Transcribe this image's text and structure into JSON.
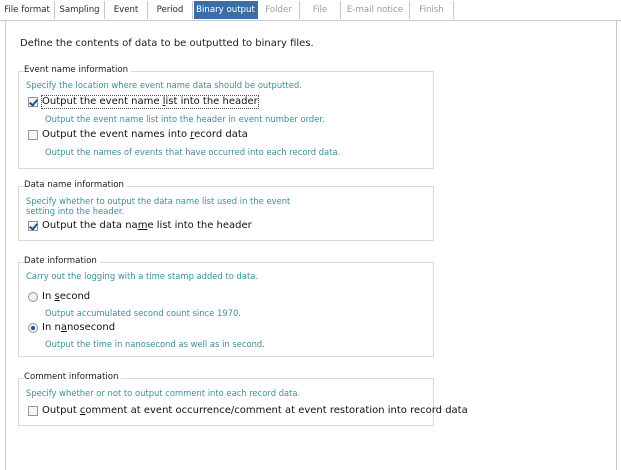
{
  "tabs": [
    {
      "label": "File format",
      "state": "normal"
    },
    {
      "label": "Sampling",
      "state": "normal"
    },
    {
      "label": "Event",
      "state": "normal"
    },
    {
      "label": "Period",
      "state": "normal"
    },
    {
      "label": "Binary output",
      "state": "active"
    },
    {
      "label": "Folder",
      "state": "disabled"
    },
    {
      "label": "File",
      "state": "disabled"
    },
    {
      "label": "E-mail notice",
      "state": "disabled"
    },
    {
      "label": "Finish",
      "state": "disabled"
    }
  ],
  "intro": "Define the contents of data to be outputted to binary files.",
  "event_name": {
    "title": "Event name information",
    "desc": "Specify the location where event name data should be outputted.",
    "opt1": {
      "pre": "Output the event name ",
      "u": "l",
      "post": "ist into the header",
      "checked": true
    },
    "opt1_desc": "Output the event name list into the header in event number order.",
    "opt2": {
      "pre": "Output the event names into ",
      "u": "r",
      "post": "ecord data",
      "checked": false
    },
    "opt2_desc": "Output the names of events that have occurred into each record data."
  },
  "data_name": {
    "title": "Data name information",
    "desc_line1": "Specify whether to output the data name list used in the event",
    "desc_line2": "setting into the header.",
    "opt": {
      "pre": "Output the data na",
      "u": "m",
      "post": "e list into the header",
      "checked": true
    }
  },
  "date_info": {
    "title": "Date information",
    "desc": "Carry out the logging with a time stamp added to data.",
    "opt1": {
      "pre": "In ",
      "u": "s",
      "post": "econd",
      "selected": false
    },
    "opt1_desc": "Output accumulated second count since 1970.",
    "opt2": {
      "pre": "In n",
      "u": "a",
      "post": "nosecond",
      "selected": true
    },
    "opt2_desc": "Output the time in nanosecond as well as in second."
  },
  "comment_info": {
    "title": "Comment information",
    "desc": "Specify whether or not to output comment into each record data.",
    "opt": {
      "pre": "Output ",
      "u": "c",
      "post": "omment at event occurrence/comment at event restoration into record data",
      "checked": false
    }
  }
}
